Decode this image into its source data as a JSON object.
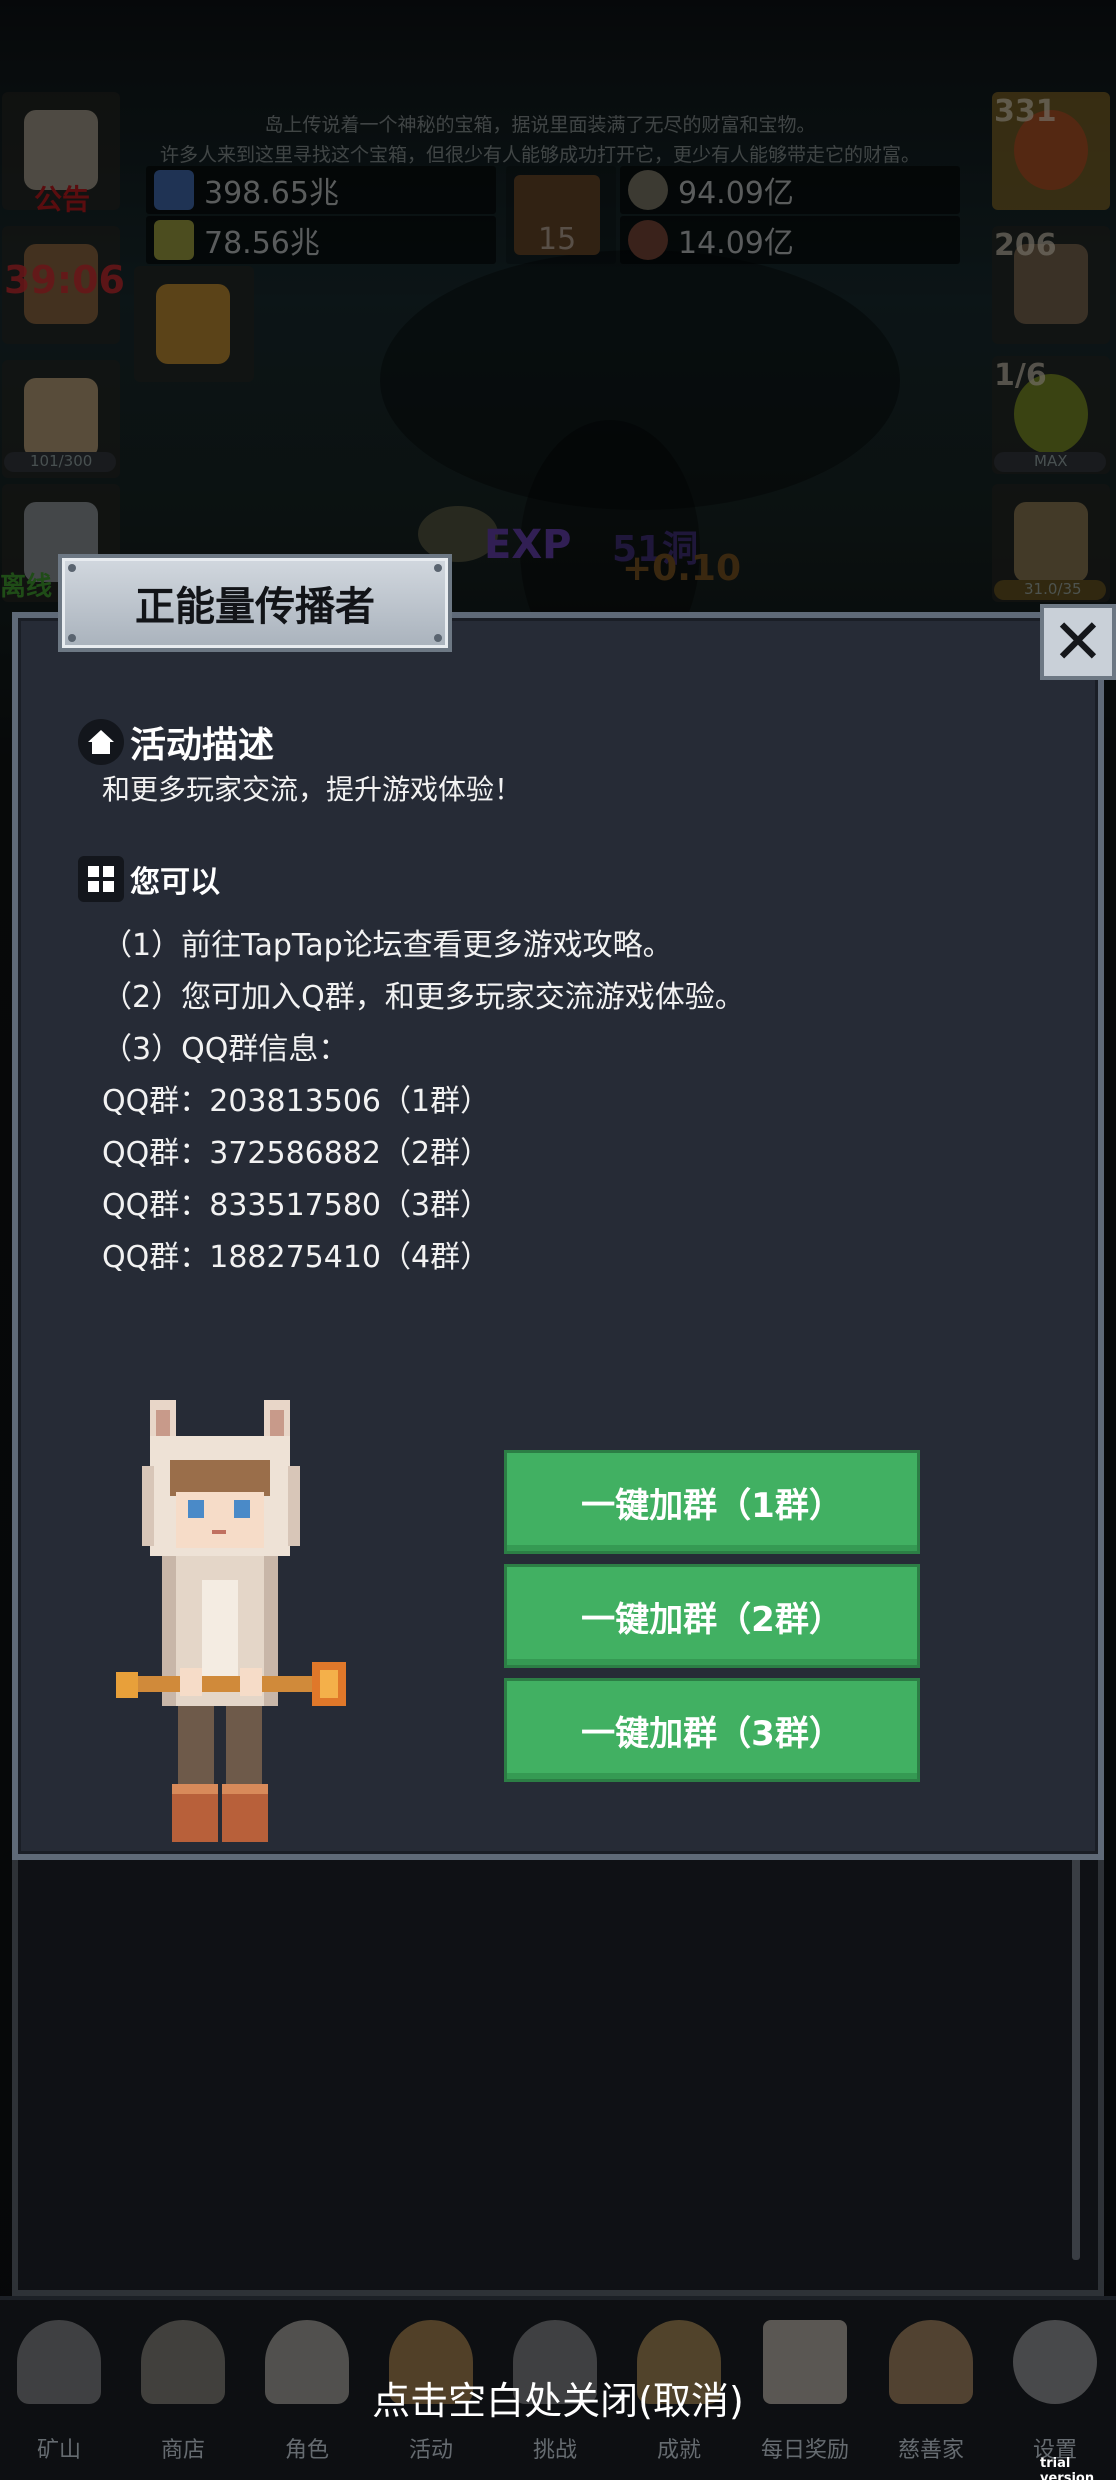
{
  "lore": {
    "line1": "岛上传说着一个神秘的宝箱，据说里面装满了无尽的财富和宝物。",
    "line2": "许多人来到这里寻找这个宝箱，但很少有人能够成功打开它，更少有人能够带走它的财富。"
  },
  "resources": {
    "blue_potion": "398.65兆",
    "yellow_potion": "78.56兆",
    "book_count": "15",
    "coin": "94.09亿",
    "meat": "14.09亿"
  },
  "left_side": {
    "notice_label": "公告",
    "timer": "39:06",
    "bread_count": "101/300",
    "offline_label": "离线"
  },
  "right_side": {
    "potion_count": "331",
    "chest_count": "206",
    "slime_count": "1/6",
    "slime_badge": "MAX",
    "sword_count": "31.0/35"
  },
  "center_hud": {
    "exp_label": "EXP",
    "level_text": "51洞",
    "exp_gain": "+0.10"
  },
  "dialog": {
    "title": "正能量传播者",
    "section1_title": "活动描述",
    "section1_text": "和更多玩家交流，提升游戏体验！",
    "section2_title": "您可以",
    "lines": [
      "（1）前往TapTap论坛查看更多游戏攻略。",
      "（2）您可加入Q群，和更多玩家交流游戏体验。",
      "（3）QQ群信息：",
      "QQ群：203813506（1群）",
      "QQ群：372586882（2群）",
      "QQ群：833517580（3群）",
      "QQ群：188275410（4群）"
    ],
    "buttons": [
      "一键加群（1群）",
      "一键加群（2群）",
      "一键加群（3群）"
    ]
  },
  "bottom_nav": {
    "items": [
      "矿山",
      "商店",
      "角色",
      "活动",
      "挑战",
      "成就",
      "每日奖励",
      "慈善家",
      "设置"
    ]
  },
  "close_hint": "点击空白处关闭(取消)",
  "watermark": "trial version",
  "colors": {
    "dialog_bg": "#262b36",
    "button_green": "#41b062",
    "timer_red": "#c0282c"
  }
}
